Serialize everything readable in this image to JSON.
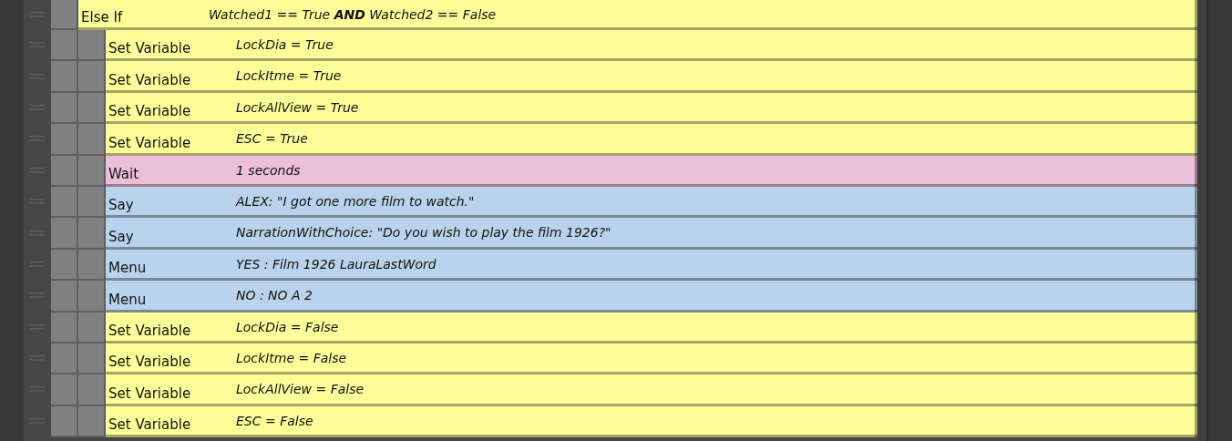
{
  "commands": [
    {
      "name": "Else If",
      "summary": "Watched1 == True **AND** Watched2 == False",
      "color": "#fdfd9a",
      "children": [
        {
          "name": "Set Variable",
          "summary": "LockDia = True",
          "color": "#fdfd9a"
        },
        {
          "name": "Set Variable",
          "summary": "LockItme = True",
          "color": "#fdfd9a"
        },
        {
          "name": "Set Variable",
          "summary": "LockAllView = True",
          "color": "#fdfd9a"
        },
        {
          "name": "Set Variable",
          "summary": "ESC = True",
          "color": "#fdfd9a"
        },
        {
          "name": "Wait",
          "summary": "1 seconds",
          "color": "#ebbfd9"
        },
        {
          "name": "Say",
          "summary": "ALEX: \"I got one more film to watch.\"",
          "color": "#b8d3eb"
        },
        {
          "name": "Say",
          "summary": "NarrationWithChoice: \"Do you wish to play the film 1926?\"",
          "color": "#b8d3eb"
        },
        {
          "name": "Menu",
          "summary": "YES : Film 1926 LauraLastWord",
          "color": "#b8d3eb"
        },
        {
          "name": "Menu",
          "summary": "NO : NO A 2",
          "color": "#b8d3eb"
        },
        {
          "name": "Set Variable",
          "summary": "LockDia = False",
          "color": "#fdfd9a"
        },
        {
          "name": "Set Variable",
          "summary": "LockItme = False",
          "color": "#fdfd9a"
        },
        {
          "name": "Set Variable",
          "summary": "LockAllView = False",
          "color": "#fdfd9a"
        },
        {
          "name": "Set Variable",
          "summary": "ESC = False",
          "color": "#fdfd9a"
        }
      ]
    }
  ]
}
